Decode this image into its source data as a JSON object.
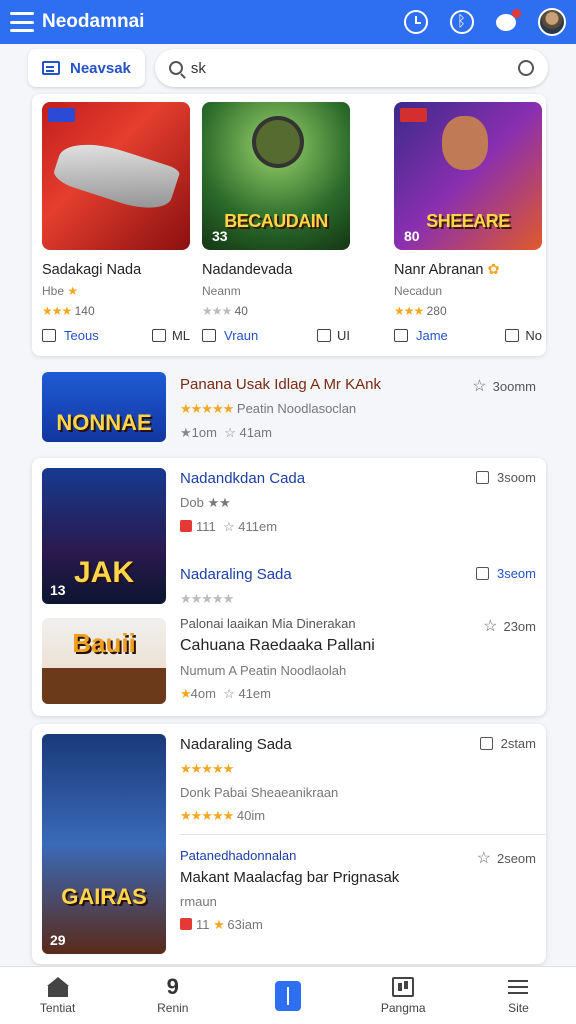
{
  "app": {
    "title": "Neodamnai"
  },
  "nav": {
    "tab_label": "Neavsak"
  },
  "search": {
    "value": "sk"
  },
  "featured": [
    {
      "badge": "",
      "num": "",
      "art_text": "",
      "name": "Sadakagi Nada",
      "sub": "Hbe",
      "rating": "140",
      "stars": "★★★",
      "like": "Teous",
      "comment": "ML"
    },
    {
      "badge": "",
      "num": "33",
      "art_text": "BECAUDAIN",
      "name": "Nadandevada",
      "sub": "Neanm",
      "rating": "40",
      "stars": "★★★",
      "like": "Vraun",
      "comment": "UI"
    },
    {
      "badge": "",
      "num": "80",
      "art_text": "SHEEARE",
      "name": "Nanr Abranan",
      "sub": "Necadun",
      "rating": "280",
      "stars": "★★★",
      "like": "Jame",
      "comment": "No"
    }
  ],
  "row1": {
    "thumb_text": "NONNAE",
    "title": "Panana Usak Idlag A Mr KAnk",
    "line2_stars": "★★★★★",
    "line2": "Peatin Noodlasoclan",
    "line3a": "1om",
    "line3b": "41am",
    "right": "3oomm"
  },
  "card1": {
    "thumb_text": "JAK",
    "thumb_num": "13",
    "thumb2_text": "Bauii",
    "items": [
      {
        "title": "Nadandkdan Cada",
        "line2": "Dob ★★",
        "line3a": "111",
        "line3b": "411em",
        "right": "3soom"
      },
      {
        "title": "Nadaraling Sada",
        "line2": "★★★★★",
        "right": "3seom"
      },
      {
        "title": "Cahuana Raedaaka Pallani",
        "pre": "Palonai laaikan Mia Dinerakan",
        "line2": "Numum A Peatin Noodlaolah",
        "line3a": "4om",
        "line3b": "41em",
        "right": "23om"
      }
    ]
  },
  "card2": {
    "thumb_text": "GAIRAS",
    "thumb_num": "29",
    "items": [
      {
        "title": "Nadaraling Sada",
        "line2": "★★★★★",
        "line3": "Donk Pabai Sheaeanikraan",
        "line4a": "★★★★★",
        "line4b": "40im",
        "right": "2stam"
      },
      {
        "title": "Makant Maalacfag bar Prignasak",
        "pre": "Patanedhadonnalan",
        "line2": "rmaun",
        "line3a": "11",
        "line3b": "63iam",
        "right": "2seom"
      }
    ]
  },
  "bottom_nav": [
    {
      "label": "Tentiat",
      "icon": "home-icon"
    },
    {
      "label": "Renin",
      "icon": "nine-icon"
    },
    {
      "label": "",
      "icon": "center-action-icon"
    },
    {
      "label": "Pangma",
      "icon": "program-icon"
    },
    {
      "label": "Site",
      "icon": "menu-lines-icon"
    }
  ]
}
